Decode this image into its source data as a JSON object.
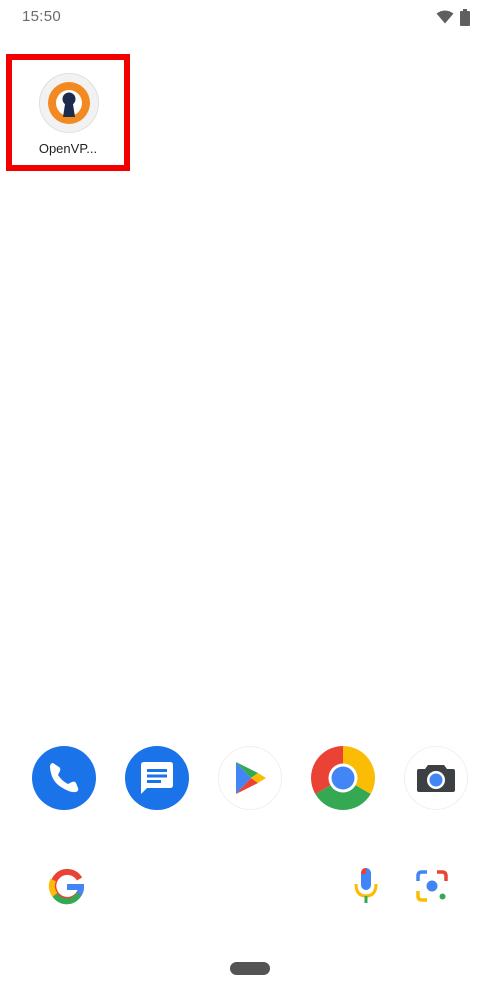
{
  "status_bar": {
    "time": "15:50",
    "icons": [
      "wifi-icon",
      "battery-icon"
    ]
  },
  "home_screen": {
    "apps": [
      {
        "label": "OpenVP...",
        "icon": "openvpn-icon",
        "highlighted": true
      }
    ]
  },
  "dock": {
    "apps": [
      {
        "icon": "phone-icon"
      },
      {
        "icon": "messages-icon"
      },
      {
        "icon": "play-store-icon"
      },
      {
        "icon": "chrome-icon"
      },
      {
        "icon": "camera-icon"
      }
    ]
  },
  "search_bar": {
    "icons": [
      "google-logo",
      "mic-icon",
      "lens-icon"
    ]
  },
  "navigation": {
    "icons": [
      "home-pill"
    ]
  },
  "colors": {
    "highlight_border": "#f20000",
    "openvpn_orange": "#f28a21",
    "openvpn_dark": "#1f2b4a",
    "phone_blue": "#1a73e8",
    "google_blue": "#4285f4",
    "google_red": "#ea4335",
    "google_yellow": "#fbbc05",
    "google_green": "#34a853"
  }
}
